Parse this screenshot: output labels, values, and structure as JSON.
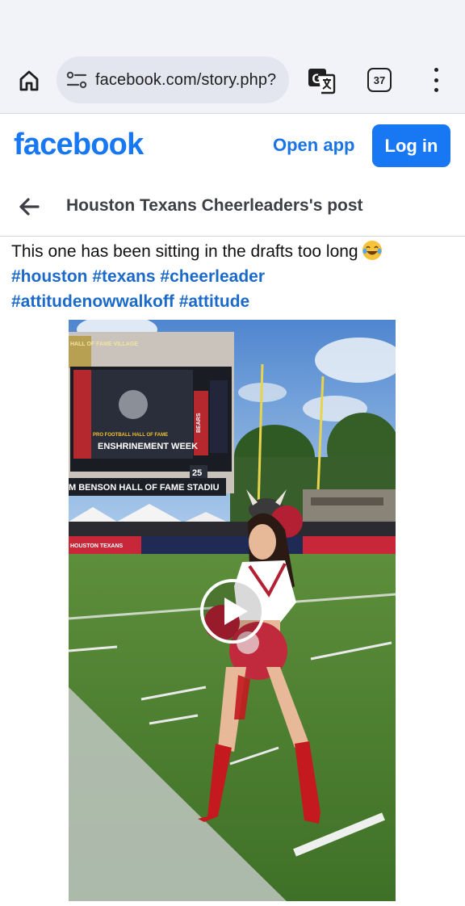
{
  "browser": {
    "url": "facebook.com/story.php?",
    "tab_count": "37",
    "icons": [
      "home-icon",
      "site-settings-icon",
      "translate-icon",
      "tabs-icon",
      "more-vert-icon"
    ]
  },
  "header": {
    "logo": "facebook",
    "open_app_label": "Open app",
    "login_label": "Log in",
    "brand_color": "#1877f2"
  },
  "post": {
    "back_icon": "arrow-left-icon",
    "title": "Houston Texans Cheerleaders's post",
    "text": "This one has been sitting in the drafts too long",
    "emoji": "laughing-with-tears-emoji",
    "hashtags": [
      "#houston",
      "#texans",
      "#cheerleader",
      "#attitudenowwalkoff",
      "#attitude"
    ]
  },
  "video": {
    "stadium_sign": "M BENSON HALL OF FAME STADIU",
    "scoreboard_banner": "PRO FOOTBALL HALL OF FAME",
    "scoreboard_text": "ENSHRINEMENT WEEK",
    "scoreboard_right": "BEARS",
    "scoreboard_number": "25",
    "wall_left": "HALL OF FAME VILLAGE",
    "ad_board": "HOUSTON TEXANS",
    "play_icon": "play-icon"
  }
}
